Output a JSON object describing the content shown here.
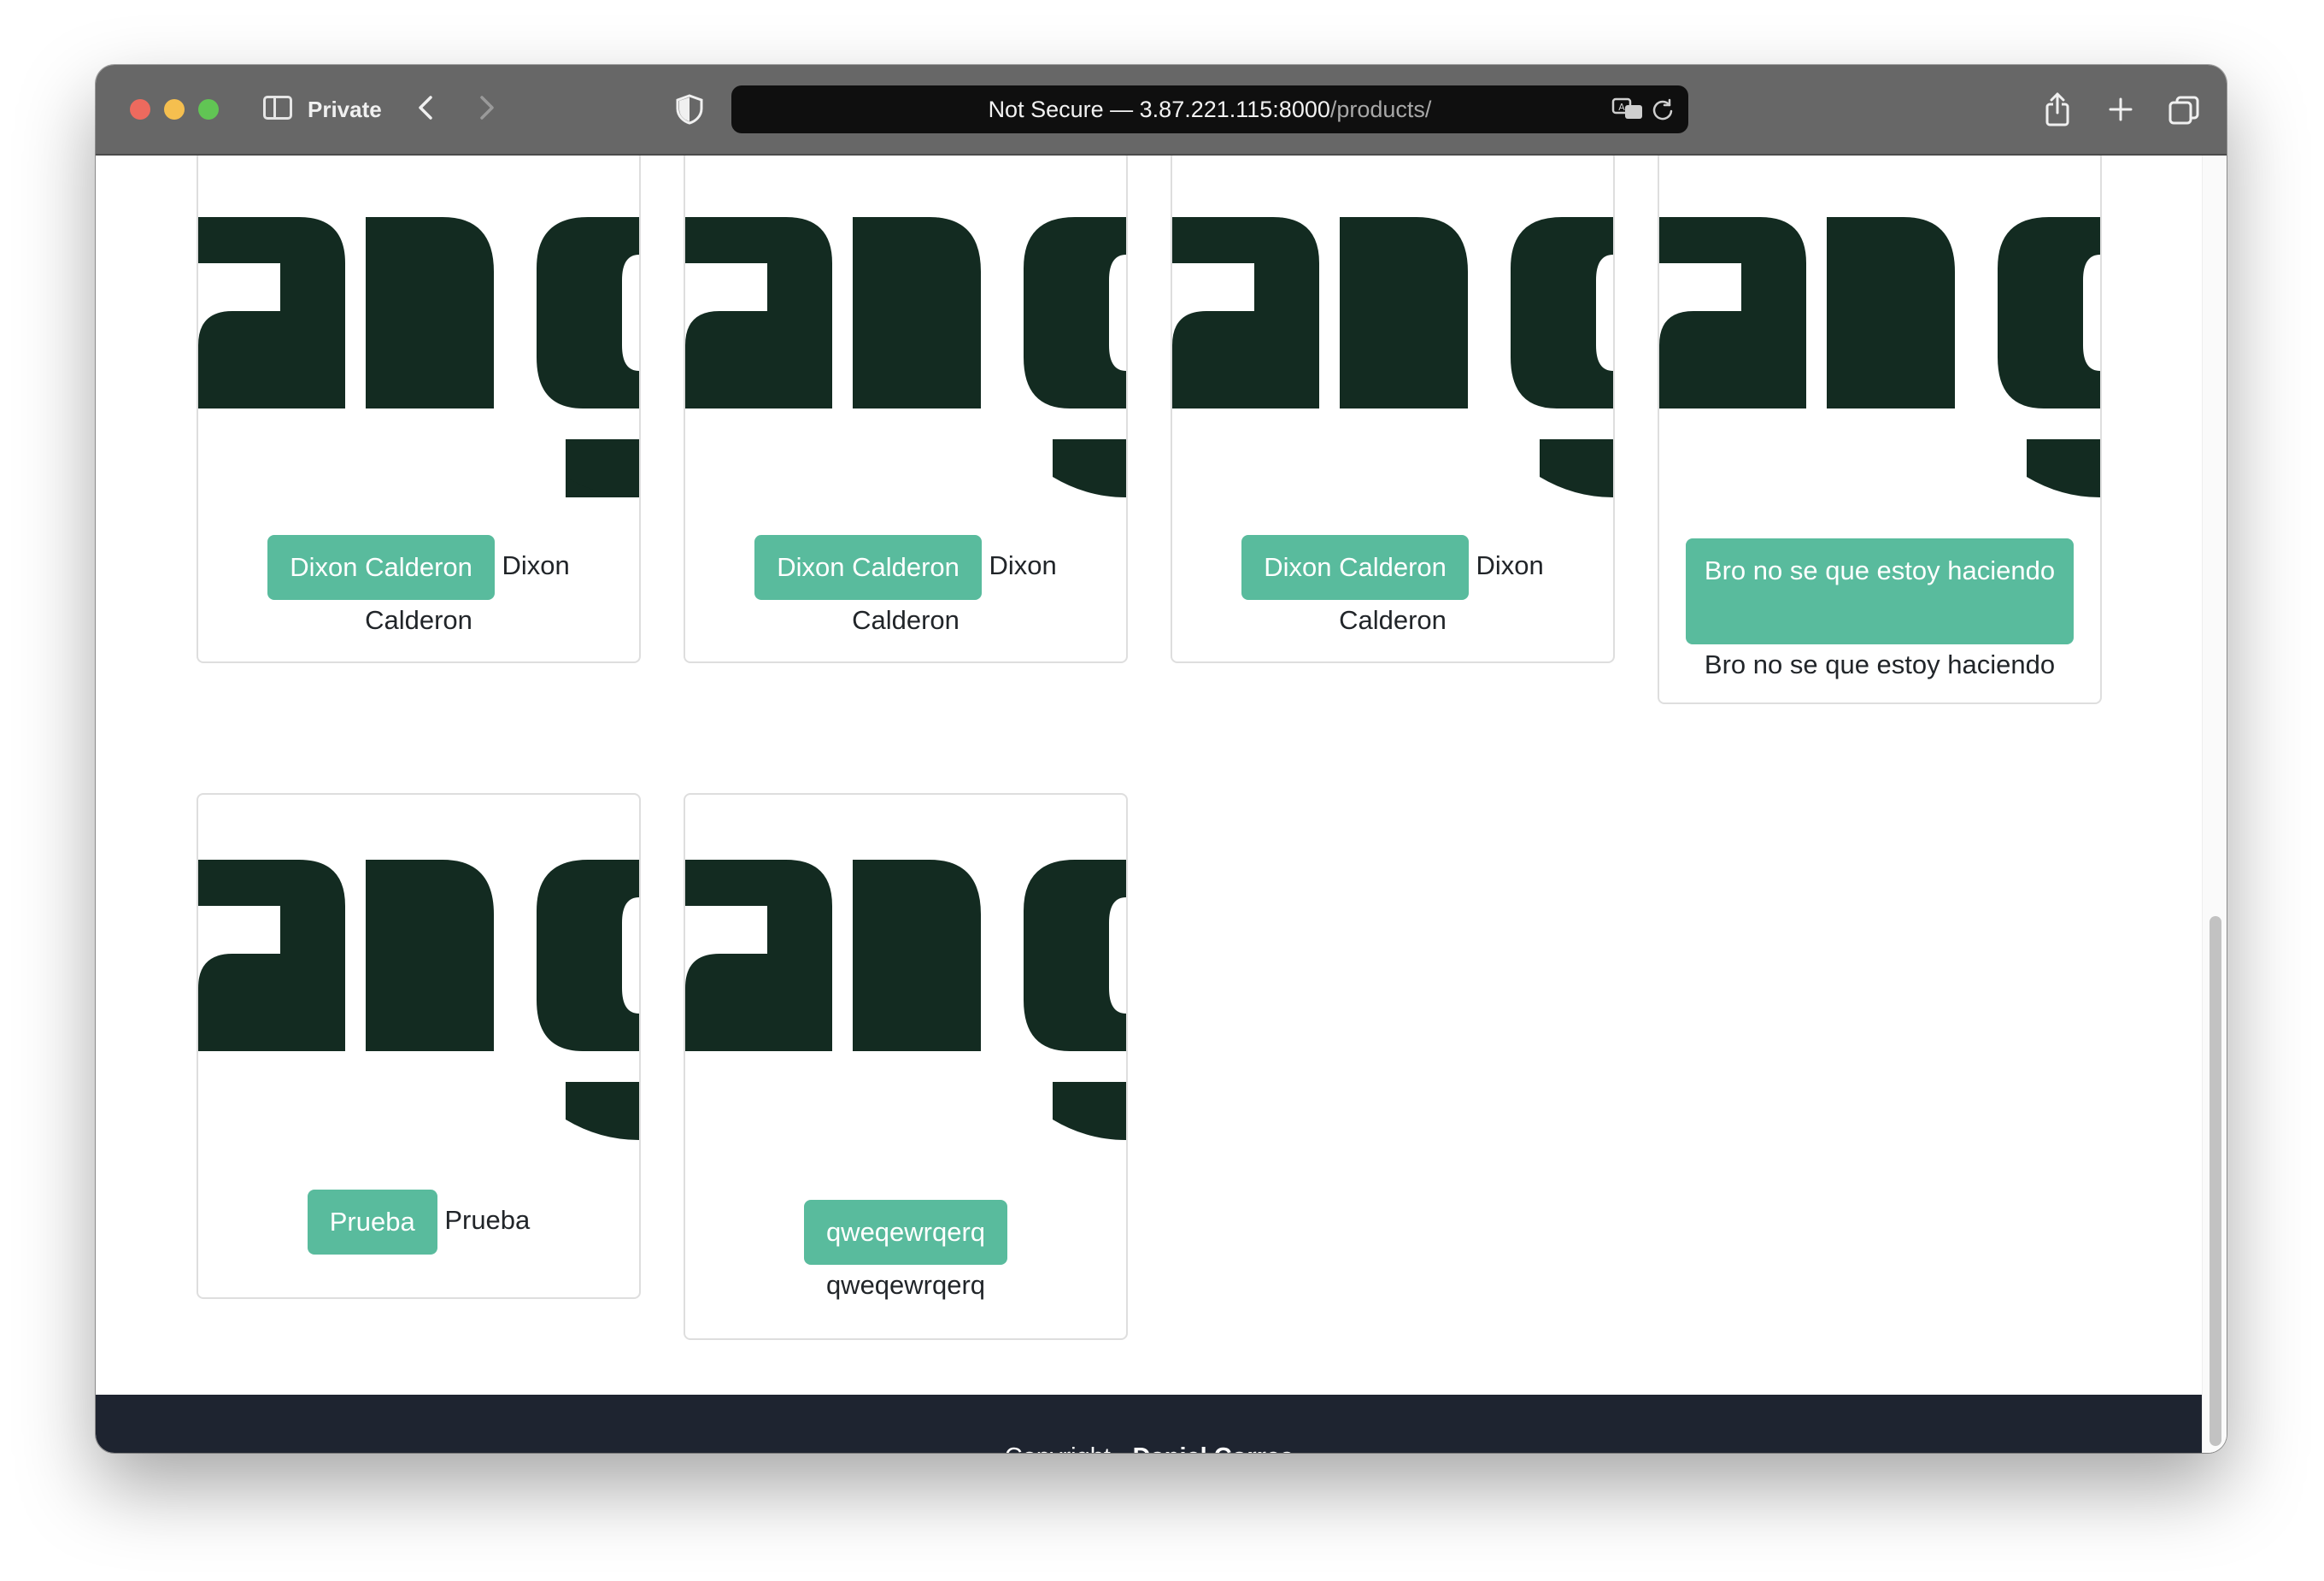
{
  "browser": {
    "mode_label": "Private",
    "address": {
      "security_label": "Not Secure —",
      "host": "3.87.221.115:8000",
      "path": "/products/"
    }
  },
  "colors": {
    "button": "#59bb9d",
    "logo": "#132b21",
    "footer": "#1e2430"
  },
  "products": [
    {
      "button_label": "Dixon Calderon",
      "name": "Dixon Calderon",
      "name_head": "Dixon",
      "name_tail": "Calderon",
      "image": "django-logo"
    },
    {
      "button_label": "Dixon Calderon",
      "name": "Dixon Calderon",
      "name_head": "Dixon",
      "name_tail": "Calderon",
      "image": "django-logo"
    },
    {
      "button_label": "Dixon Calderon",
      "name": "Dixon Calderon",
      "name_head": "Dixon",
      "name_tail": "Calderon",
      "image": "django-logo"
    },
    {
      "button_label": "Bro no se que estoy haciendo",
      "name": "Bro no se que estoy haciendo",
      "image": "django-logo"
    },
    {
      "button_label": "Prueba",
      "name": "Prueba",
      "image": "django-logo"
    },
    {
      "button_label": "qweqewrqerq",
      "name": "qweqewrqerq",
      "image": "django-logo"
    }
  ],
  "footer": {
    "prefix": "Copyright -",
    "author": "Daniel Correa"
  }
}
